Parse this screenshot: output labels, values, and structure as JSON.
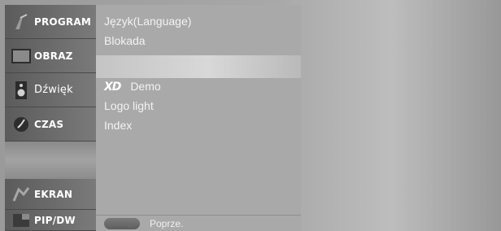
{
  "sidebar": {
    "items": [
      {
        "label": "PROGRAM",
        "icon": "antenna-icon"
      },
      {
        "label": "OBRAZ",
        "icon": "screen-icon"
      },
      {
        "label": "Dźwięk",
        "icon": "speaker-icon"
      },
      {
        "label": "CZAS",
        "icon": "clock-icon"
      },
      {
        "label": "EKRAN",
        "icon": "display-adjust-icon"
      },
      {
        "label": "PIP/DW",
        "icon": "pip-icon"
      }
    ]
  },
  "submenu": {
    "items": [
      {
        "label": "Język(Language)"
      },
      {
        "label": "Blokada"
      },
      {
        "label": "Demo",
        "logo": "XD"
      },
      {
        "label": "Logo light"
      },
      {
        "label": "Index"
      }
    ],
    "footer": {
      "prev_label": "Poprze."
    }
  }
}
